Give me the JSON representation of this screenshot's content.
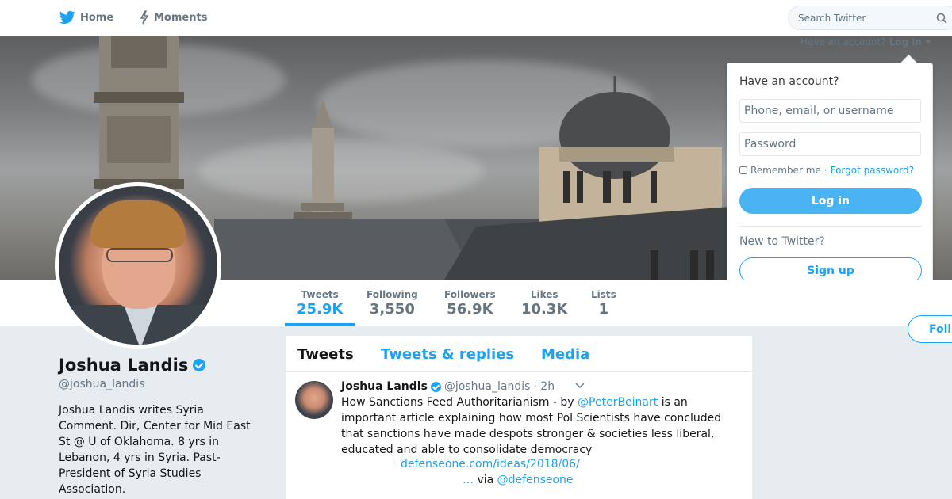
{
  "nav": {
    "home_label": "Home",
    "moments_label": "Moments",
    "search_placeholder": "Search Twitter"
  },
  "account_bar": {
    "prompt": "Have an account?",
    "login_label": "Log in"
  },
  "login_dropdown": {
    "title": "Have an account?",
    "username_placeholder": "Phone, email, or username",
    "password_placeholder": "Password",
    "remember_label": "Remember me",
    "separator": "·",
    "forgot_label": "Forgot password?",
    "login_button": "Log in",
    "new_prompt": "New to Twitter?",
    "signup_button": "Sign up"
  },
  "stats": [
    {
      "label": "Tweets",
      "value": "25.9K"
    },
    {
      "label": "Following",
      "value": "3,550"
    },
    {
      "label": "Followers",
      "value": "56.9K"
    },
    {
      "label": "Likes",
      "value": "10.3K"
    },
    {
      "label": "Lists",
      "value": "1"
    }
  ],
  "follow_button": "Foll",
  "profile": {
    "name": "Joshua Landis",
    "handle": "@joshua_landis",
    "bio": "Joshua Landis writes Syria Comment. Dir, Center for Mid East St @ U of Oklahoma. 8 yrs in Lebanon, 4 yrs in Syria. Past-President of Syria Studies Association."
  },
  "timeline": {
    "tabs": [
      "Tweets",
      "Tweets & replies",
      "Media"
    ],
    "tweet": {
      "name": "Joshua Landis",
      "handle": "@joshua_landis",
      "time": "· 2h",
      "text_before": "How Sanctions Feed Authoritarianism - by ",
      "mention": "@PeterBeinart",
      "text_after": " is an important article explaining how most Pol Scientists have concluded that sanctions have made despots stronger & societies less liberal, educated and able to consolidate democracy",
      "link": "defenseone.com/ideas/2018/06/",
      "ellipsis": "…",
      "via": " via ",
      "via_mention": "@defenseone"
    }
  },
  "colors": {
    "accent": "#1da1f2",
    "login_button": "#4ab3f4",
    "background": "#e6ecf0"
  }
}
